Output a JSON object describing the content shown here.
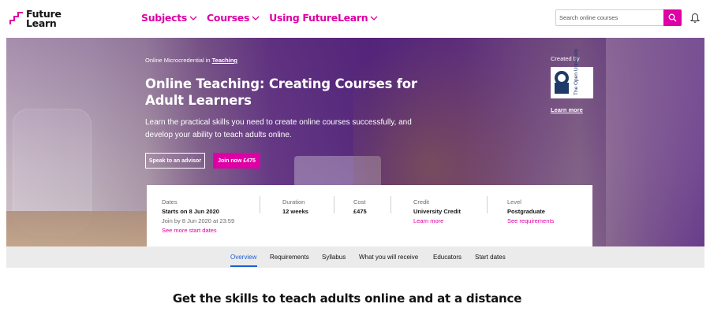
{
  "header": {
    "logo_line1": "Future",
    "logo_line2": "Learn",
    "nav": [
      {
        "label": "Subjects"
      },
      {
        "label": "Courses"
      },
      {
        "label": "Using FutureLearn"
      }
    ],
    "search_placeholder": "Search online courses",
    "accent_color": "#de00a5"
  },
  "hero": {
    "crumb_prefix": "Online Microcredential in",
    "crumb_link": "Teaching",
    "title": "Online Teaching: Creating Courses for Adult Learners",
    "description": "Learn the practical skills you need to create online courses successfully, and develop your ability to teach adults online.",
    "advisor_button": "Speak to an advisor",
    "join_button": "Join now £475",
    "created_by": "Created by",
    "partner_logo_text": "The Open University",
    "partner_learn_more": "Learn more"
  },
  "info": {
    "dates": {
      "label": "Dates",
      "value": "Starts on 8 Jun 2020",
      "sub": "Join by 8 Jun 2020 at 23:59",
      "link": "See more start dates"
    },
    "duration": {
      "label": "Duration",
      "value": "12 weeks"
    },
    "cost": {
      "label": "Cost",
      "value": "£475"
    },
    "credit": {
      "label": "Credit",
      "value": "University Credit",
      "link": "Learn more"
    },
    "level": {
      "label": "Level",
      "value": "Postgraduate",
      "link": "See requirements"
    }
  },
  "tabs": [
    {
      "label": "Overview",
      "active": true
    },
    {
      "label": "Requirements"
    },
    {
      "label": "Syllabus"
    },
    {
      "label": "What you will receive"
    },
    {
      "label": "Educators"
    },
    {
      "label": "Start dates"
    }
  ],
  "section_title": "Get the skills to teach adults online and at a distance"
}
